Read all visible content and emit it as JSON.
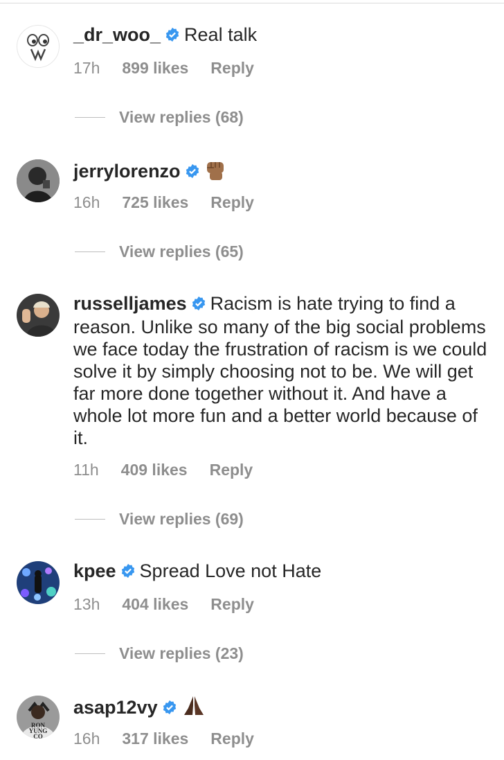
{
  "comments": [
    {
      "username": "_dr_woo_",
      "text": "Real talk",
      "time": "17h",
      "likes": "899 likes",
      "reply": "Reply",
      "view_replies": "View replies (68)"
    },
    {
      "username": "jerrylorenzo",
      "text": "",
      "emoji": "raised-fist-emoji",
      "time": "16h",
      "likes": "725 likes",
      "reply": "Reply",
      "view_replies": "View replies (65)"
    },
    {
      "username": "russelljames",
      "text": "Racism is hate trying to find a reason. Unlike so many of the big social problems we face today the frustration of racism is we could solve it by simply choosing not to be. We will get far more done together without it. And have a whole lot more fun and a better world because of it.",
      "time": "11h",
      "likes": "409 likes",
      "reply": "Reply",
      "view_replies": "View replies (69)"
    },
    {
      "username": "kpee",
      "text": "Spread Love not Hate",
      "time": "13h",
      "likes": "404 likes",
      "reply": "Reply",
      "view_replies": "View replies (23)"
    },
    {
      "username": "asap12vy",
      "text": "",
      "emoji": "folded-hands-emoji",
      "time": "16h",
      "likes": "317 likes",
      "reply": "Reply"
    }
  ],
  "avatar_text": {
    "asap12vy": "RON YUNG CO"
  },
  "colors": {
    "verified": "#3897f0",
    "muted": "#8e8e8e",
    "text": "#262626"
  }
}
